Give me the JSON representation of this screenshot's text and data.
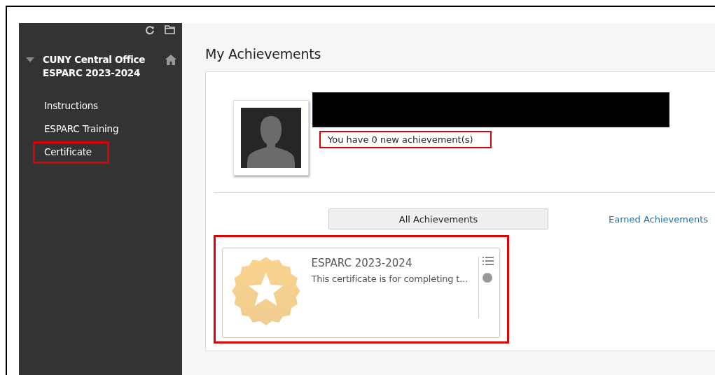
{
  "sidebar": {
    "course_title": "CUNY Central Office ESPARC 2023-2024",
    "expanded": true,
    "items": [
      {
        "label": "Instructions",
        "highlighted": false
      },
      {
        "label": "ESPARC Training",
        "highlighted": false
      },
      {
        "label": "Certificate",
        "highlighted": true
      }
    ]
  },
  "page_title": "My Achievements",
  "profile": {
    "name_redacted": true,
    "summary": "You have 0 new achievement(s)",
    "summary_highlighted": true
  },
  "tabs": [
    {
      "label": "All Achievements",
      "selected": true
    },
    {
      "label": "Earned Achievements",
      "selected": false
    }
  ],
  "achievements": [
    {
      "title": "ESPARC 2023-2024",
      "description": "This certificate is for completing t...",
      "earned": false,
      "highlighted": true
    }
  ]
}
